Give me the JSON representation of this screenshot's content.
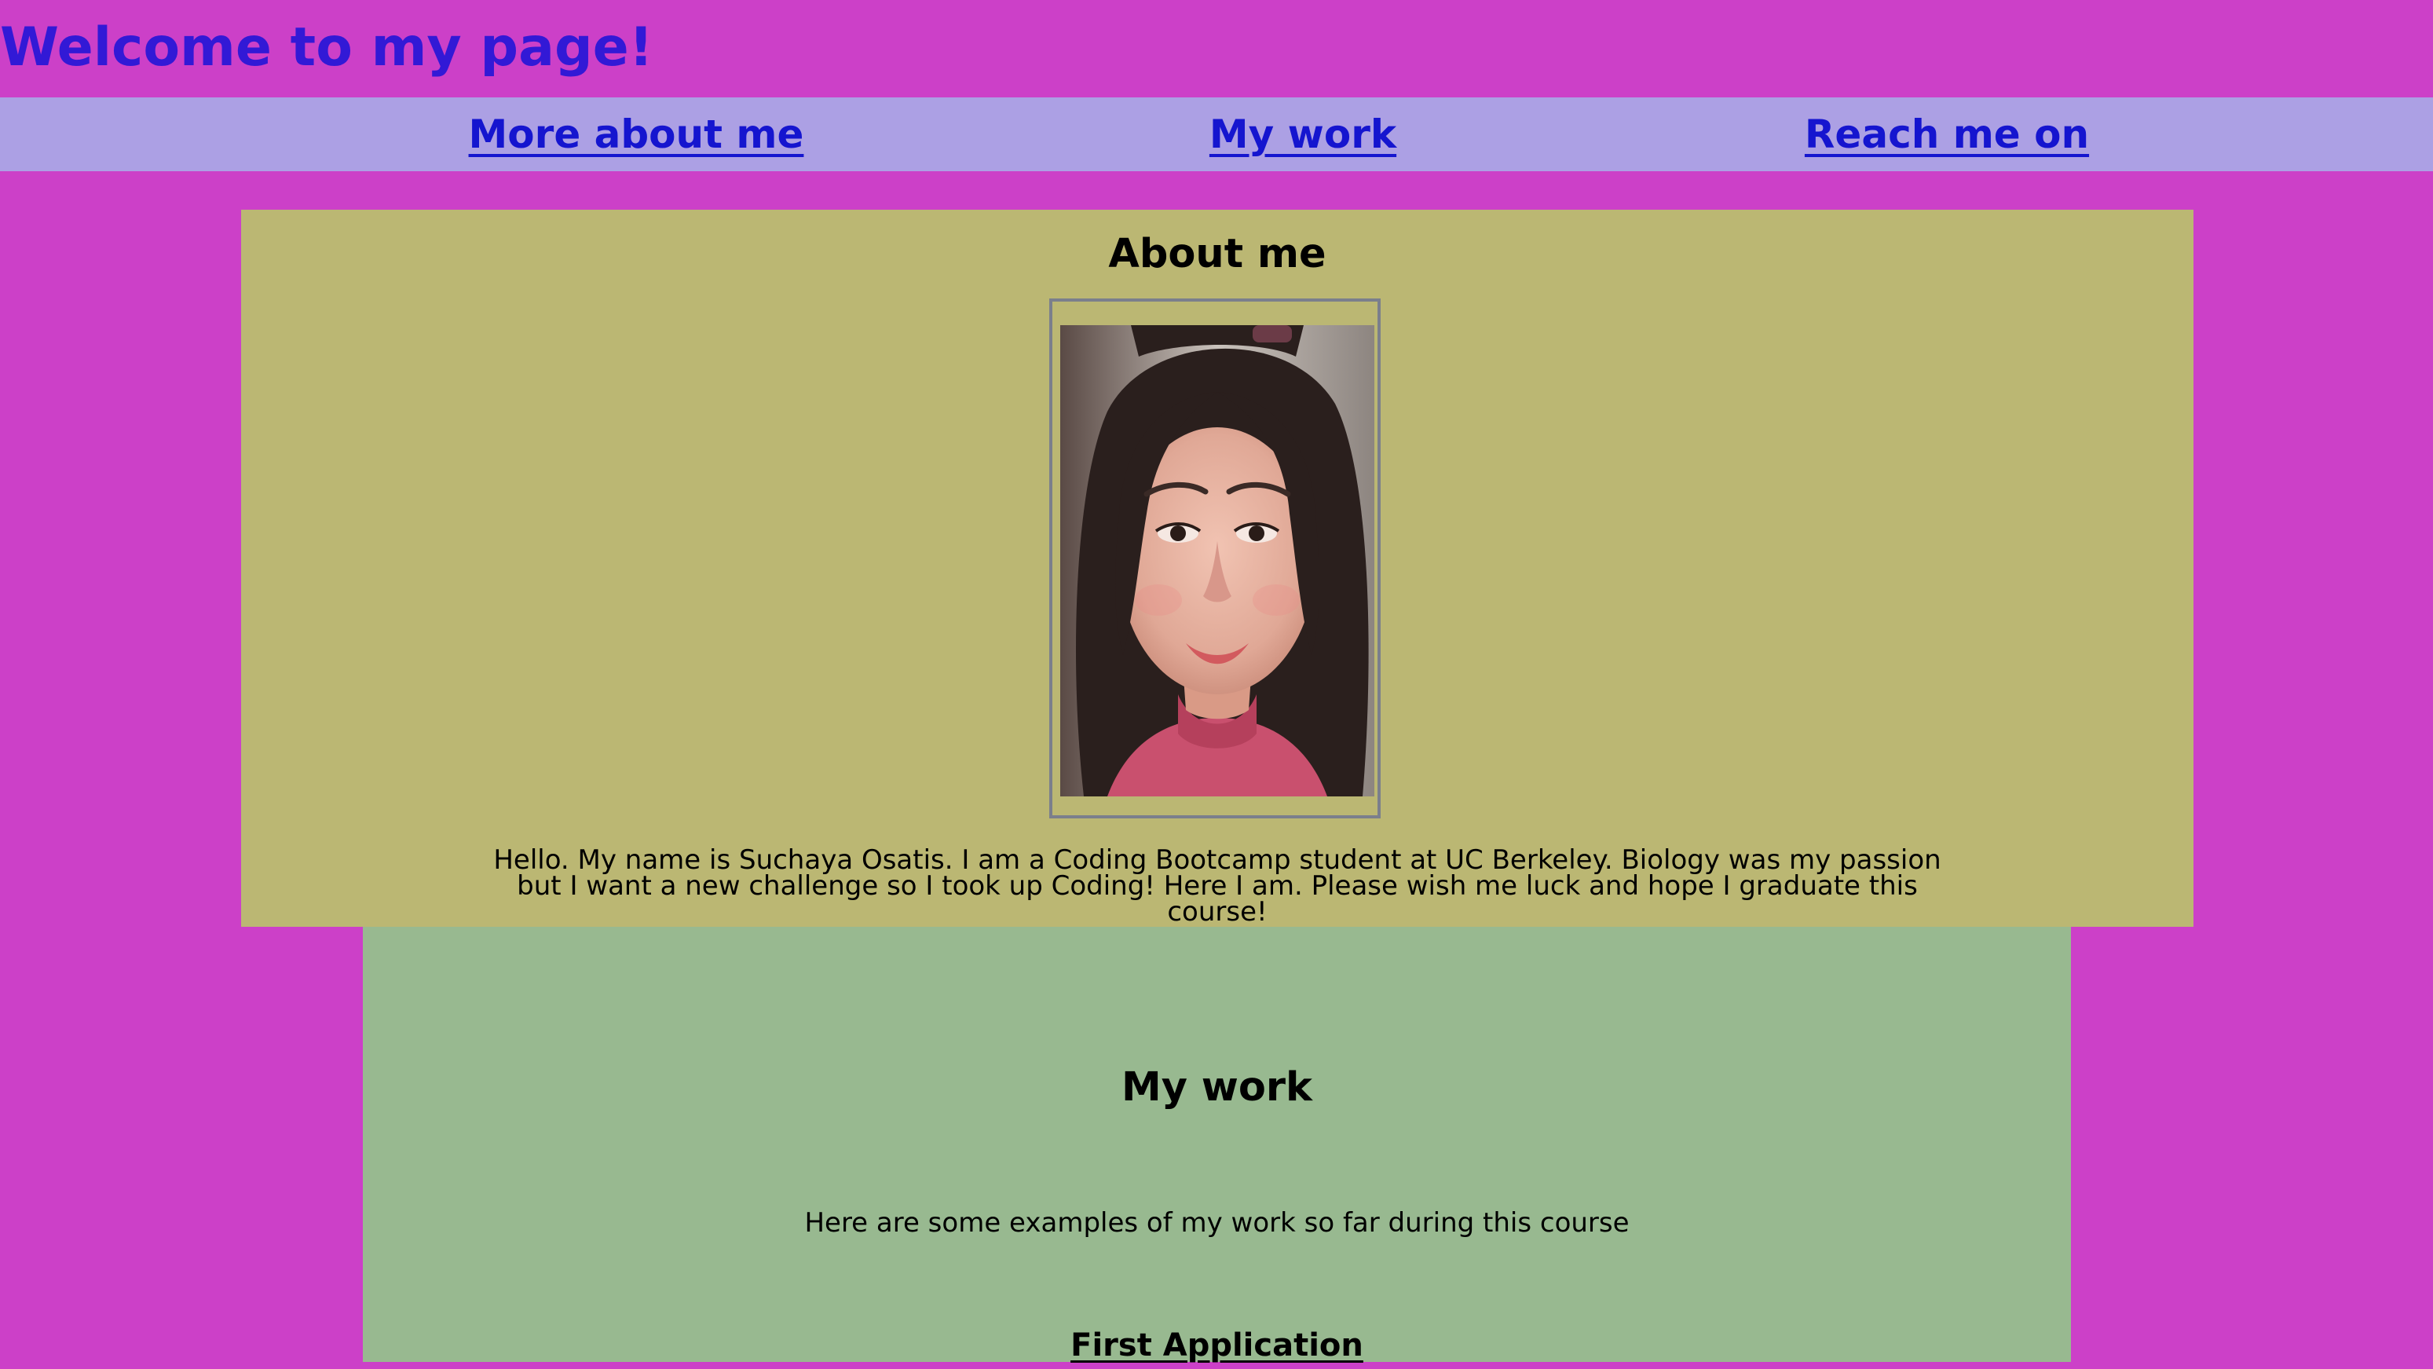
{
  "header": {
    "title": "Welcome to my page!"
  },
  "nav": {
    "items": [
      {
        "label": "More about me"
      },
      {
        "label": "My work"
      },
      {
        "label": "Reach me on"
      }
    ]
  },
  "about": {
    "heading": "About me",
    "photo_alt": "portrait-photo",
    "text": "Hello. My name is Suchaya Osatis. I am a Coding Bootcamp student at UC Berkeley. Biology was my passion but I want a new challenge so I took up Coding! Here I am. Please wish me luck and hope I graduate this course!"
  },
  "work": {
    "heading": "My work",
    "intro": "Here are some examples of my work so far during this course",
    "projects": [
      {
        "label": "First Application"
      }
    ]
  },
  "colors": {
    "page_background": "#cc40c8",
    "title": "#3219d6",
    "nav_background": "#aca0e4",
    "nav_link": "#1515cf",
    "about_background": "#bbb773",
    "work_background": "#98b990",
    "photo_border": "#7b7f8c"
  }
}
